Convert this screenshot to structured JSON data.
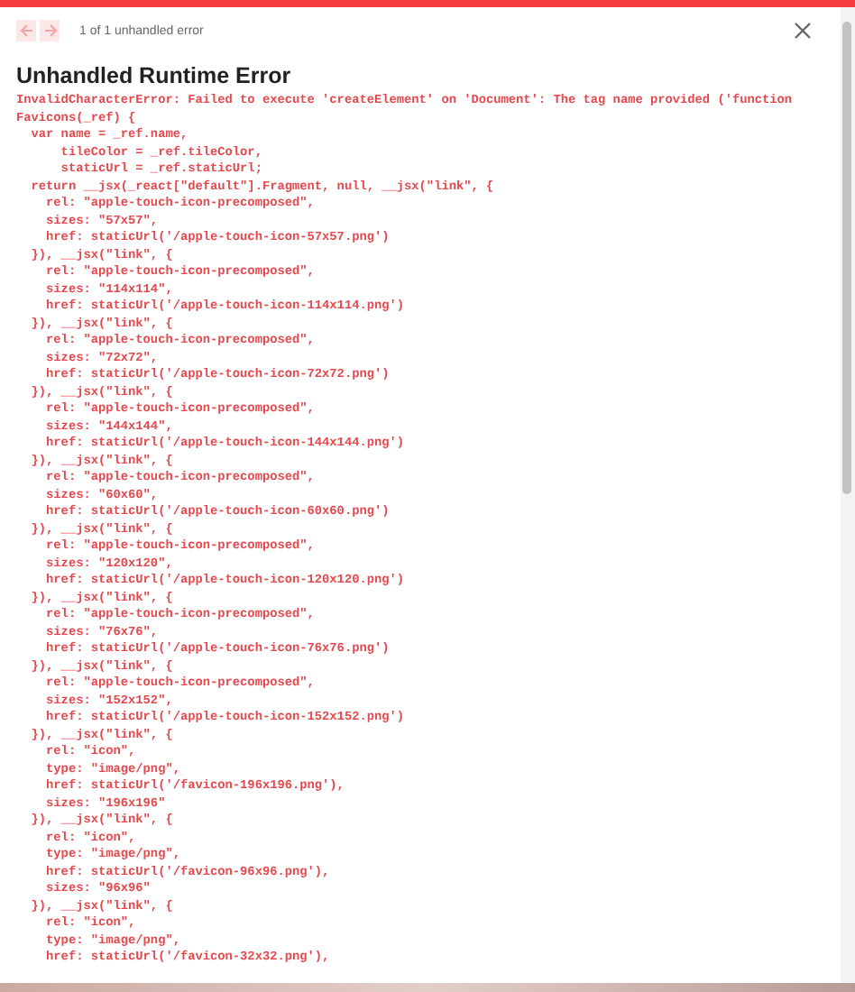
{
  "nav": {
    "buttons": [
      {
        "kind": "previous",
        "disabled": true
      },
      {
        "kind": "next",
        "disabled": true
      }
    ],
    "counter": "1 of 1 unhandled error"
  },
  "title": "Unhandled Runtime Error",
  "message": "InvalidCharacterError: Failed to execute 'createElement' on 'Document': The tag name provided ('function\nFavicons(_ref) {\n  var name = _ref.name,\n      tileColor = _ref.tileColor,\n      staticUrl = _ref.staticUrl;\n  return __jsx(_react[\"default\"].Fragment, null, __jsx(\"link\", {\n    rel: \"apple-touch-icon-precomposed\",\n    sizes: \"57x57\",\n    href: staticUrl('/apple-touch-icon-57x57.png')\n  }), __jsx(\"link\", {\n    rel: \"apple-touch-icon-precomposed\",\n    sizes: \"114x114\",\n    href: staticUrl('/apple-touch-icon-114x114.png')\n  }), __jsx(\"link\", {\n    rel: \"apple-touch-icon-precomposed\",\n    sizes: \"72x72\",\n    href: staticUrl('/apple-touch-icon-72x72.png')\n  }), __jsx(\"link\", {\n    rel: \"apple-touch-icon-precomposed\",\n    sizes: \"144x144\",\n    href: staticUrl('/apple-touch-icon-144x144.png')\n  }), __jsx(\"link\", {\n    rel: \"apple-touch-icon-precomposed\",\n    sizes: \"60x60\",\n    href: staticUrl('/apple-touch-icon-60x60.png')\n  }), __jsx(\"link\", {\n    rel: \"apple-touch-icon-precomposed\",\n    sizes: \"120x120\",\n    href: staticUrl('/apple-touch-icon-120x120.png')\n  }), __jsx(\"link\", {\n    rel: \"apple-touch-icon-precomposed\",\n    sizes: \"76x76\",\n    href: staticUrl('/apple-touch-icon-76x76.png')\n  }), __jsx(\"link\", {\n    rel: \"apple-touch-icon-precomposed\",\n    sizes: \"152x152\",\n    href: staticUrl('/apple-touch-icon-152x152.png')\n  }), __jsx(\"link\", {\n    rel: \"icon\",\n    type: \"image/png\",\n    href: staticUrl('/favicon-196x196.png'),\n    sizes: \"196x196\"\n  }), __jsx(\"link\", {\n    rel: \"icon\",\n    type: \"image/png\",\n    href: staticUrl('/favicon-96x96.png'),\n    sizes: \"96x96\"\n  }), __jsx(\"link\", {\n    rel: \"icon\",\n    type: \"image/png\",\n    href: staticUrl('/favicon-32x32.png'),"
}
